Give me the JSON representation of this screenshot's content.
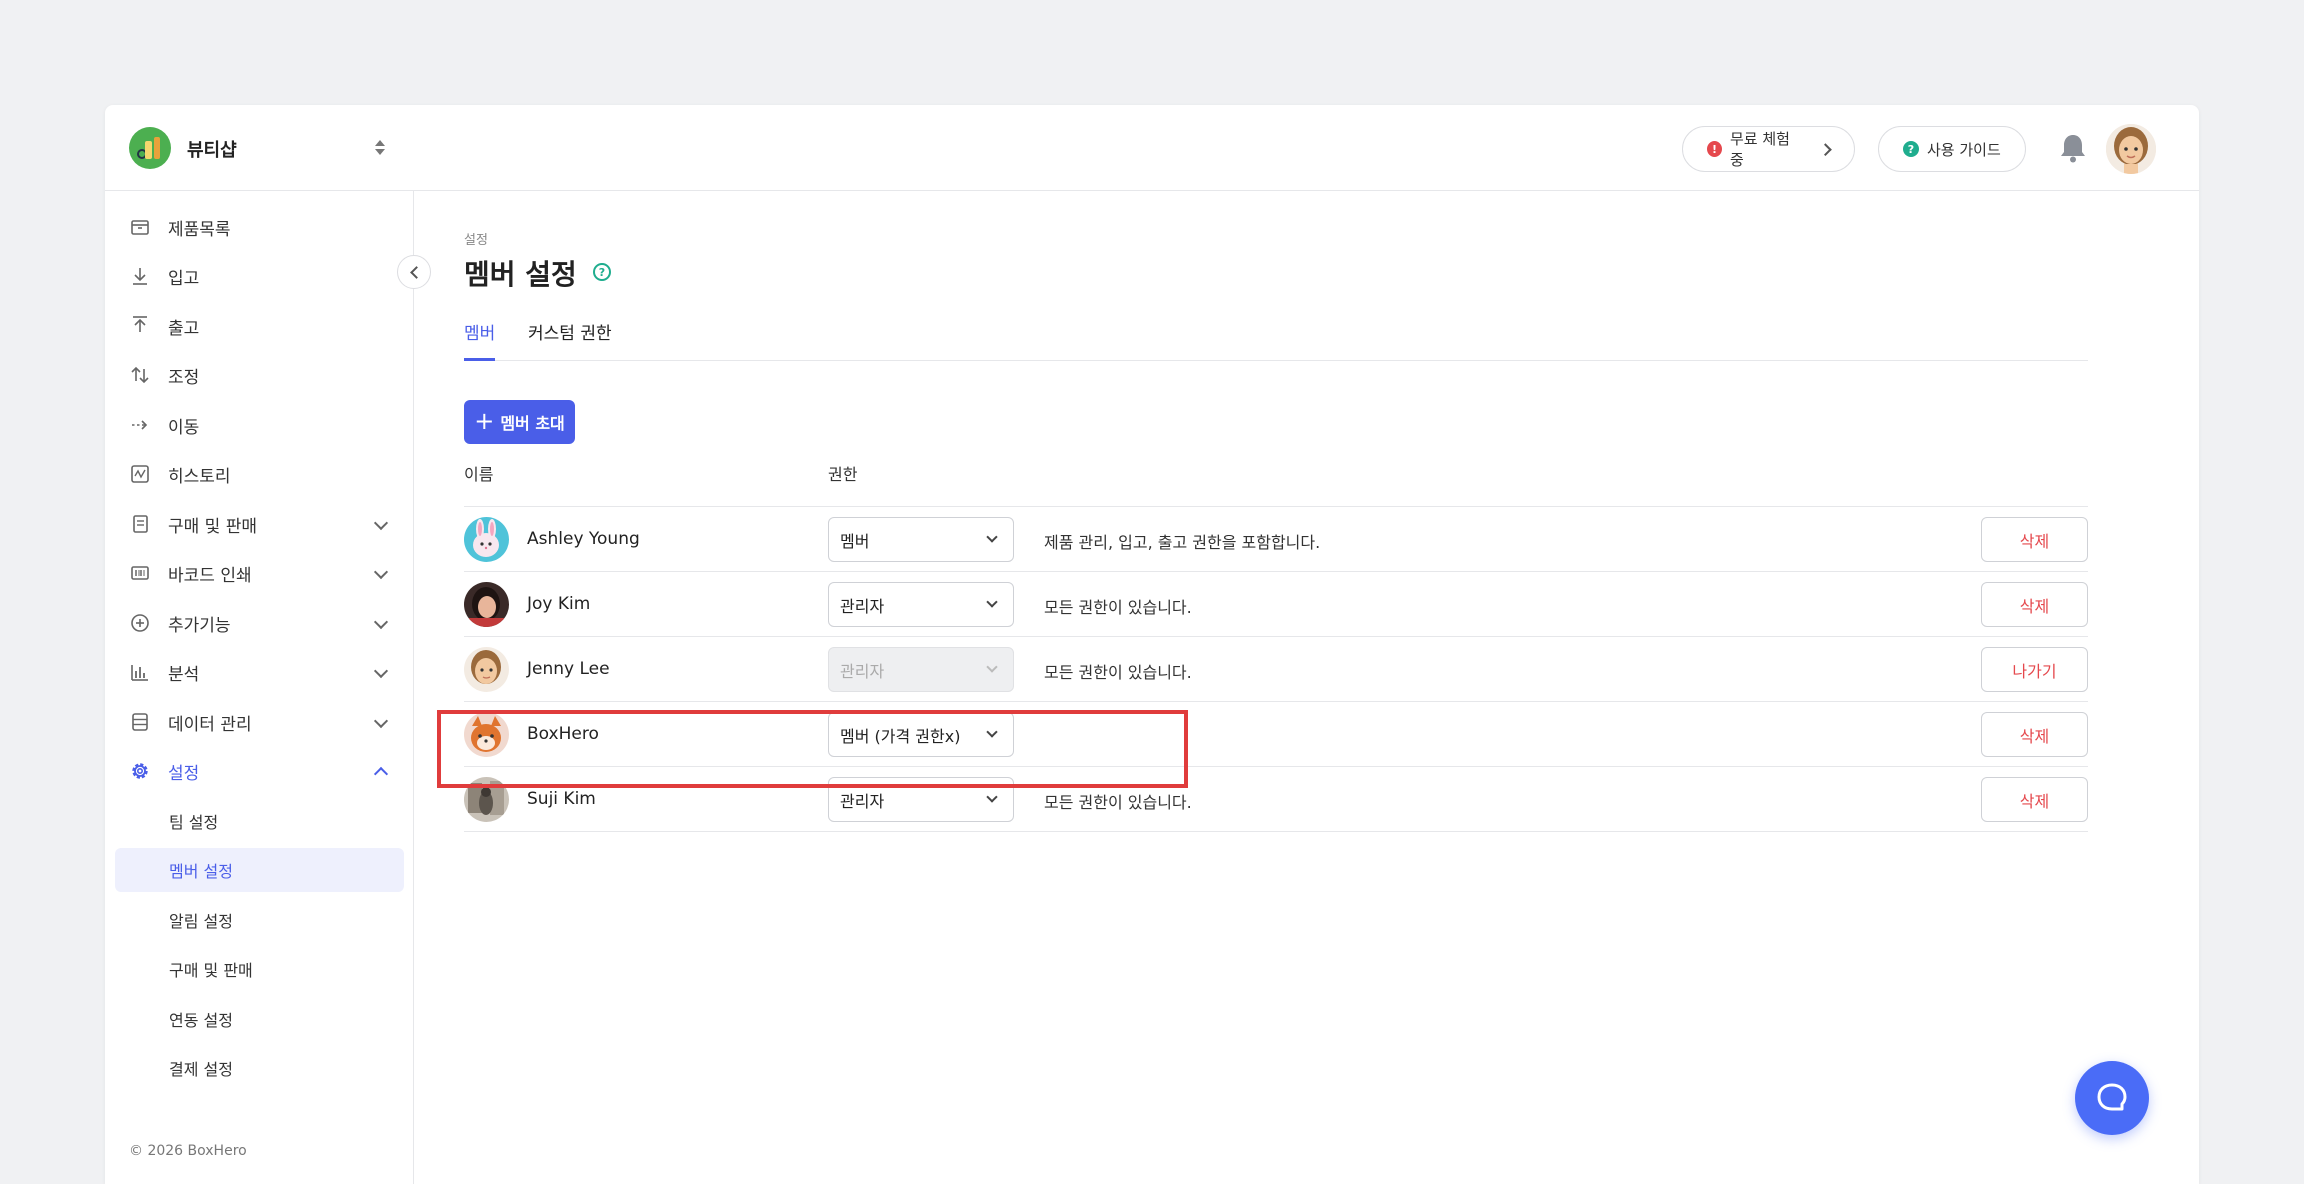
{
  "header": {
    "team_name": "뷰티샵",
    "trial_label": "무료 체험 중",
    "guide_label": "사용 가이드"
  },
  "sidebar": {
    "items": [
      {
        "label": "제품목록",
        "icon": "box-icon"
      },
      {
        "label": "입고",
        "icon": "download-arrow-icon"
      },
      {
        "label": "출고",
        "icon": "upload-arrow-icon"
      },
      {
        "label": "조정",
        "icon": "swap-arrows-icon"
      },
      {
        "label": "이동",
        "icon": "dashed-arrow-icon"
      },
      {
        "label": "히스토리",
        "icon": "history-icon"
      },
      {
        "label": "구매 및 판매",
        "icon": "document-icon"
      },
      {
        "label": "바코드 인쇄",
        "icon": "barcode-icon"
      },
      {
        "label": "추가기능",
        "icon": "plus-circle-icon"
      },
      {
        "label": "분석",
        "icon": "bar-chart-icon"
      },
      {
        "label": "데이터 관리",
        "icon": "database-icon"
      },
      {
        "label": "설정",
        "icon": "gear-icon"
      }
    ],
    "settings_sub": [
      "팀 설정",
      "멤버 설정",
      "알림 설정",
      "구매 및 판매",
      "연동 설정",
      "결제 설정"
    ],
    "copyright": "© 2026 BoxHero"
  },
  "main": {
    "breadcrumb": "설정",
    "title": "멤버 설정",
    "tabs": [
      "멤버",
      "커스텀 권한"
    ],
    "invite_label": "멤버 초대",
    "columns": [
      "이름",
      "권한"
    ],
    "members": [
      {
        "name": "Ashley Young",
        "role": "멤버",
        "desc": "제품 관리, 입고, 출고 권한을 포함합니다.",
        "action": "삭제"
      },
      {
        "name": "Joy Kim",
        "role": "관리자",
        "desc": "모든 권한이 있습니다.",
        "action": "삭제"
      },
      {
        "name": "Jenny Lee",
        "role": "관리자",
        "desc": "모든 권한이 있습니다.",
        "action": "나가기"
      },
      {
        "name": "BoxHero",
        "role": "멤버 (가격 권한x)",
        "desc": "",
        "action": "삭제"
      },
      {
        "name": "Suji Kim",
        "role": "관리자",
        "desc": "모든 권한이 있습니다.",
        "action": "삭제"
      }
    ]
  },
  "colors": {
    "accent": "#4a5ee8",
    "danger": "#e5484d",
    "highlight": "#e03c3c"
  }
}
